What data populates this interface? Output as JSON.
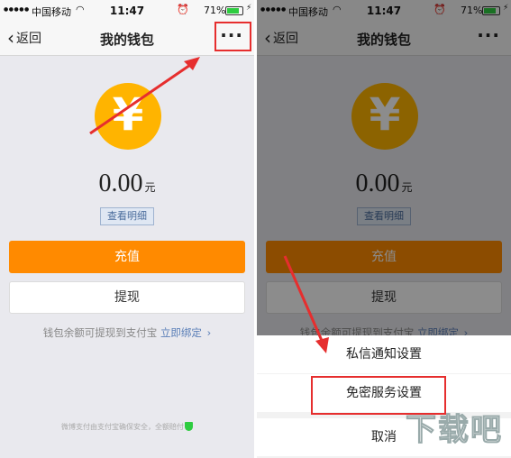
{
  "status_bar": {
    "carrier": "中国移动",
    "time": "11:47",
    "battery": "71%",
    "battery_level": 0.71
  },
  "nav": {
    "back_label": "返回",
    "title": "我的钱包",
    "more_label": "···"
  },
  "wallet": {
    "currency_symbol": "¥",
    "balance": "0.00",
    "unit": "元",
    "detail_button": "查看明细",
    "recharge_button": "充值",
    "withdraw_button": "提现",
    "hint_text": "钱包余额可提现到支付宝",
    "hint_link": "立即绑定",
    "hint_arrow": "›",
    "footer_note": "微博支付由支付宝确保安全，全额赔付"
  },
  "action_sheet": {
    "items": [
      "私信通知设置",
      "免密服务设置",
      "取消"
    ]
  },
  "watermark": {
    "text": "下载吧",
    "url": "www.xiazaiba.com"
  },
  "colors": {
    "accent": "#ff8a00",
    "coin": "#ffb400",
    "highlight": "#e62e2e",
    "link": "#5b7fb8"
  }
}
